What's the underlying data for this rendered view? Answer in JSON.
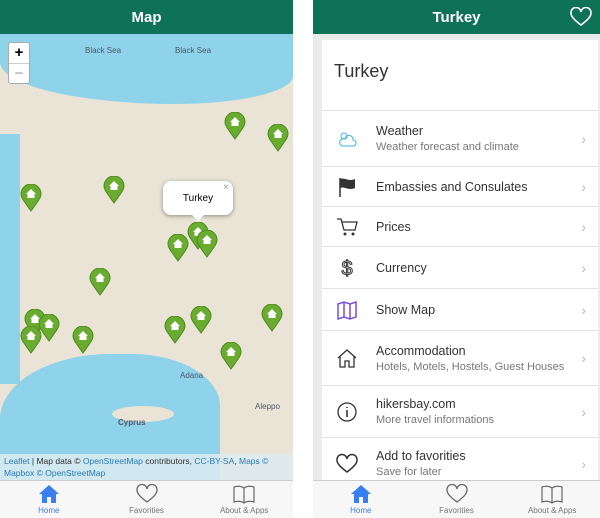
{
  "left": {
    "title": "Map",
    "zoom_in": "+",
    "zoom_out": "−",
    "map_labels": {
      "sea": "Black Sea",
      "sea2": "Black Sea",
      "cyprus": "Cyprus",
      "aleppo": "Aleppo",
      "adana": "Adana"
    },
    "popup": {
      "text": "Turkey",
      "close": "×"
    },
    "attribution": {
      "leaflet": "Leaflet",
      "sep": " | Map data © ",
      "osm": "OpenStreetMap",
      "contrib": " contributors, ",
      "license": "CC-BY-SA",
      "comma": ", ",
      "maps": "Maps © Mapbox © OpenStreetMap"
    },
    "tabs": [
      {
        "label": "Home",
        "icon": "home-icon"
      },
      {
        "label": "Favorities",
        "icon": "heart-icon"
      },
      {
        "label": "About & Apps",
        "icon": "book-icon"
      }
    ]
  },
  "right": {
    "title": "Turkey",
    "card_title": "Turkey",
    "items": [
      {
        "title": "Weather",
        "subtitle": "Weather forecast and climate",
        "icon": "weather-icon"
      },
      {
        "title": "Embassies and Consulates",
        "icon": "flag-icon"
      },
      {
        "title": "Prices",
        "icon": "cart-icon"
      },
      {
        "title": "Currency",
        "icon": "dollar-icon"
      },
      {
        "title": "Show Map",
        "icon": "map-icon"
      },
      {
        "title": "Accommodation",
        "subtitle": "Hotels, Motels, Hostels, Guest Houses",
        "icon": "house-icon"
      },
      {
        "title": "hikersbay.com",
        "subtitle": "More travel informations",
        "icon": "info-icon"
      },
      {
        "title": "Add to favorities",
        "subtitle": "Save for later",
        "icon": "heart-icon"
      }
    ],
    "tabs": [
      {
        "label": "Home"
      },
      {
        "label": "Favorities"
      },
      {
        "label": "About & Apps"
      }
    ]
  },
  "colors": {
    "header": "#0e7256",
    "active_tab": "#3a7ff0",
    "pin": "#6aac2f"
  }
}
